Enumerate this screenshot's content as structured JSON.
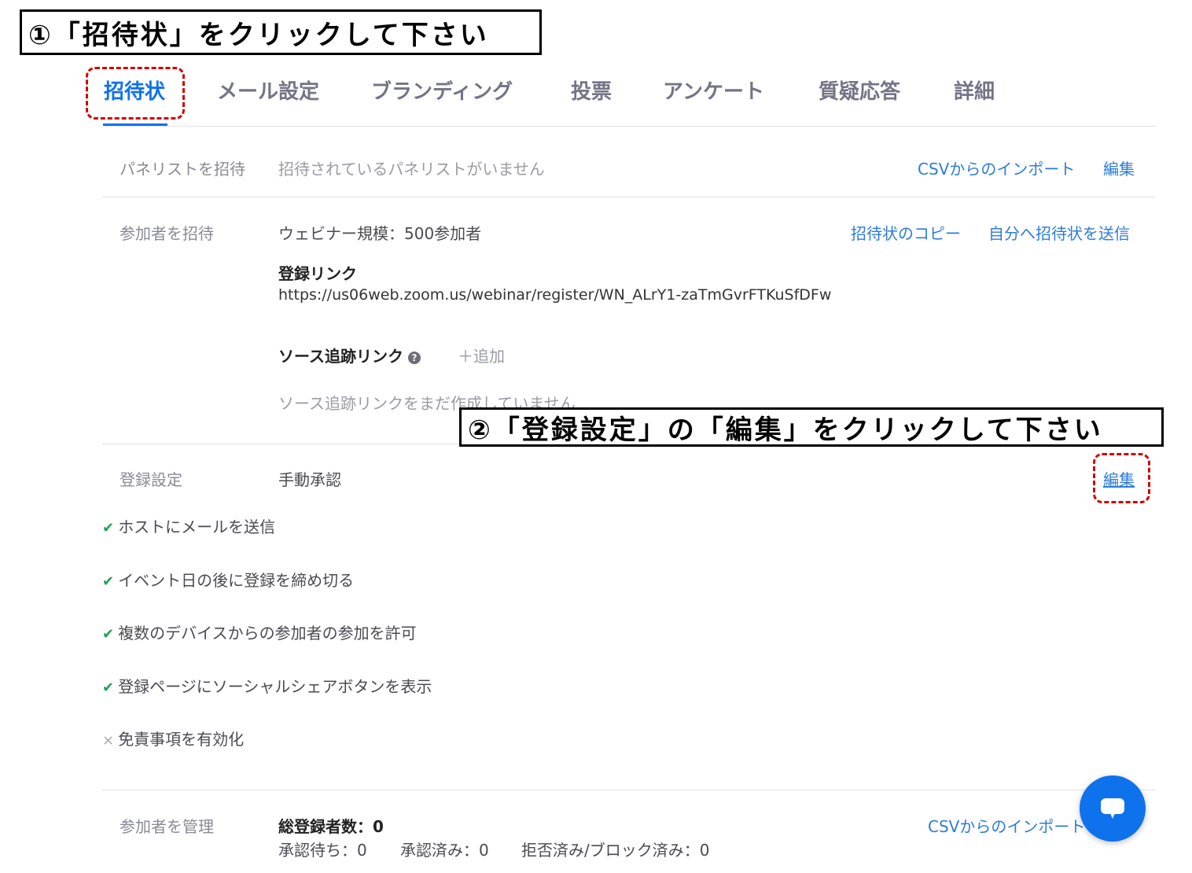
{
  "callouts": {
    "step1": "①「招待状」をクリックして下さい",
    "step2": "②「登録設定」の「編集」をクリックして下さい"
  },
  "tabs": [
    {
      "label": "招待状",
      "active": true
    },
    {
      "label": "メール設定"
    },
    {
      "label": "ブランディング"
    },
    {
      "label": "投票"
    },
    {
      "label": "アンケート"
    },
    {
      "label": "質疑応答"
    },
    {
      "label": "詳細"
    }
  ],
  "panelists": {
    "label": "パネリストを招待",
    "empty_text": "招待されているパネリストがいません",
    "import_csv": "CSVからのインポート",
    "edit": "編集"
  },
  "attendees": {
    "label": "参加者を招待",
    "capacity": "ウェビナー規模：500参加者",
    "copy_invitation": "招待状のコピー",
    "send_to_self": "自分へ招待状を送信",
    "registration_link_title": "登録リンク",
    "registration_link_url": "https://us06web.zoom.us/webinar/register/WN_ALrY1-zaTmGvrFTKuSfDFw",
    "source_tracking_title": "ソース追跡リンク",
    "help_icon_glyph": "?",
    "add": "＋追加",
    "source_tracking_empty": "ソース追跡リンクをまだ作成していません"
  },
  "registration": {
    "label": "登録設定",
    "value": "手動承認",
    "edit": "編集",
    "options": [
      {
        "text": "ホストにメールを送信",
        "enabled": true
      },
      {
        "text": "イベント日の後に登録を締め切る",
        "enabled": true
      },
      {
        "text": "複数のデバイスからの参加者の参加を許可",
        "enabled": true
      },
      {
        "text": "登録ページにソーシャルシェアボタンを表示",
        "enabled": true
      },
      {
        "text": "免責事項を有効化",
        "enabled": false
      }
    ],
    "check_glyph": "✔",
    "cross_glyph": "×"
  },
  "manage": {
    "label": "参加者を管理",
    "total_label": "総登録者数：",
    "total_value": "0",
    "pending": "承認待ち：0",
    "approved": "承認済み：0",
    "denied": "拒否済み/ブロック済み：0",
    "import_csv": "CSVからのインポート"
  },
  "icons": {
    "chat": "chat-bubble-icon"
  },
  "colors": {
    "accent": "#0e72ed",
    "link": "#2d7cd8",
    "highlight": "#d00000",
    "check": "#23a05a"
  }
}
